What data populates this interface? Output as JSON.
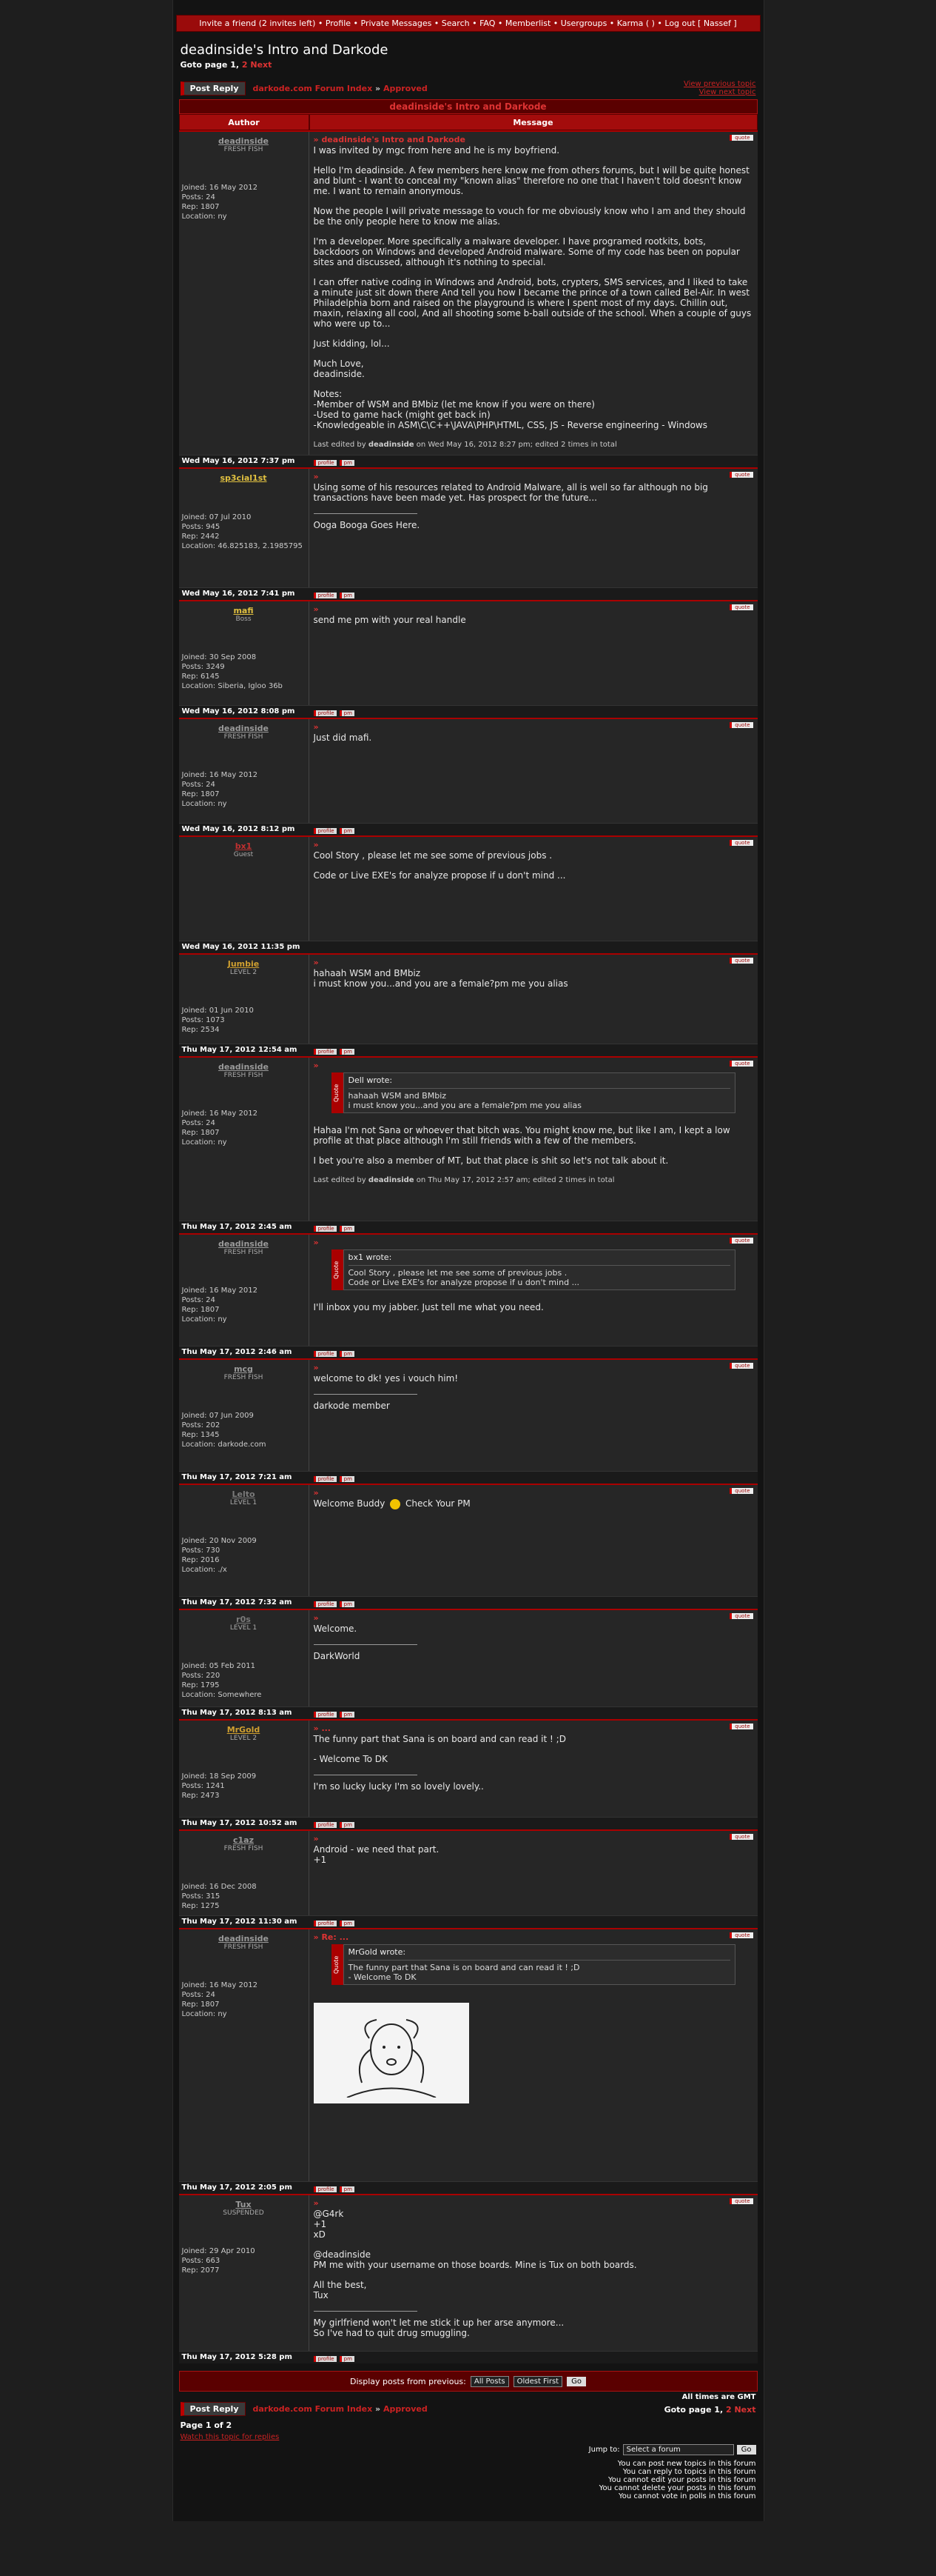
{
  "topnav": {
    "text": "Invite a friend (2 invites left) • Profile • Private Messages • Search • FAQ • Memberlist • Usergroups • Karma ( ) • Log out [ Nassef ]"
  },
  "thread": {
    "title": "deadinside's Intro and Darkode",
    "goto_prefix": "Goto page",
    "goto_current": "1, ",
    "page2": "2",
    "next": "Next"
  },
  "toolbar": {
    "post_reply": "Post Reply",
    "crumb_index": "darkode.com Forum Index",
    "crumb_sep": " » ",
    "crumb_forum": "Approved",
    "prev_topic": "View previous topic",
    "next_topic": "View next topic"
  },
  "table": {
    "thread_header": "deadinside's Intro and Darkode",
    "col_author": "Author",
    "col_message": "Message"
  },
  "labels": {
    "quote": "quote",
    "profile": "profile",
    "pm": "pm",
    "quote_side": "Quote",
    "edited_prefix": "Last edited by",
    "edited_on": "on"
  },
  "posts": [
    {
      "author": "deadinside",
      "rank": "FRESH FISH",
      "color": "#9a9a9a",
      "joined": "Joined: 16 May 2012",
      "posts": "Posts: 24",
      "rep": "Rep: 1807",
      "location": "Location: ny",
      "subject": "deadinside's Intro and Darkode",
      "date": "Wed May 16, 2012 7:37 pm",
      "paras": [
        "I was invited by mgc from here and he is my boyfriend.",
        "Hello I'm deadinside. A few members here know me from others forums, but I will be quite honest and blunt - I want to conceal my \"known alias\" therefore no one that I haven't told doesn't know me. I want to remain anonymous.",
        "Now the people I will private message to vouch for me obviously know who I am and they should be the only people here to know me alias.",
        "I'm a developer. More specifically a malware developer. I have programed rootkits, bots, backdoors on Windows and developed Android malware. Some of my code has been on popular sites and discussed, although it's nothing to special.",
        "I can offer native coding in Windows and Android, bots, crypters, SMS services, and I liked to take a minute just sit down there And tell you how I became the prince of a town called Bel-Air. In west Philadelphia born and raised on the playground is where I spent most of my days. Chillin out, maxin, relaxing all cool, And all shooting some b-ball outside of the school. When a couple of guys who were up to...",
        "Just kidding, lol...",
        "Much Love,\ndeadinside.",
        "Notes:\n-Member of WSM and BMbiz (let me know if you were on there)\n-Used to game hack (might get back in)\n-Knowledgeable in ASM\\C\\C++\\JAVA\\PHP\\HTML, CSS, JS - Reverse engineering - Windows"
      ],
      "edited": {
        "who": "deadinside",
        "when": "Wed May 16, 2012 8:27 pm; edited 2 times in total"
      }
    },
    {
      "author": "sp3cial1st",
      "rank": "",
      "color": "#e0c040",
      "joined": "Joined: 07 Jul 2010",
      "posts": "Posts: 945",
      "rep": "Rep: 2442",
      "location": "Location: 46.825183, 2.1985795",
      "subject": "",
      "date": "Wed May 16, 2012 7:41 pm",
      "paras": [
        "Using some of his resources related to Android Malware, all is well so far although no big transactions have been made yet. Has prospect for the future..."
      ],
      "sig": "Ooga Booga Goes Here."
    },
    {
      "author": "mafi",
      "rank": "Boss",
      "color": "#e0c040",
      "joined": "Joined: 30 Sep 2008",
      "posts": "Posts: 3249",
      "rep": "Rep: 6145",
      "location": "Location: Siberia, Igloo 36b",
      "subject": "",
      "date": "Wed May 16, 2012 8:08 pm",
      "paras": [
        "send me pm with your real handle"
      ]
    },
    {
      "author": "deadinside",
      "rank": "FRESH FISH",
      "color": "#9a9a9a",
      "joined": "Joined: 16 May 2012",
      "posts": "Posts: 24",
      "rep": "Rep: 1807",
      "location": "Location: ny",
      "subject": "",
      "date": "Wed May 16, 2012 8:12 pm",
      "paras": [
        "Just did mafi."
      ]
    },
    {
      "author": "bx1",
      "rank": "Guest",
      "color": "#c03030",
      "joined": "",
      "posts": "",
      "rep": "",
      "location": "",
      "subject": "",
      "date": "Wed May 16, 2012 11:35 pm",
      "paras": [
        "Cool Story , please let me see some of previous jobs .",
        "Code or Live EXE's for analyze propose if u don't mind ..."
      ]
    },
    {
      "author": "Jumbie",
      "rank": "LEVEL 2",
      "color": "#d0a030",
      "joined": "Joined: 01 Jun 2010",
      "posts": "Posts: 1073",
      "rep": "Rep: 2534",
      "location": "",
      "subject": "",
      "date": "Thu May 17, 2012 12:54 am",
      "paras": [
        "hahaah WSM and BMbiz\ni must know you...and you are a female?pm me you alias"
      ]
    },
    {
      "author": "deadinside",
      "rank": "FRESH FISH",
      "color": "#9a9a9a",
      "joined": "Joined: 16 May 2012",
      "posts": "Posts: 24",
      "rep": "Rep: 1807",
      "location": "Location: ny",
      "subject": "",
      "date": "Thu May 17, 2012 2:45 am",
      "quote": {
        "who": "Dell wrote:",
        "lines": [
          "hahaah WSM and BMbiz",
          "i must know you...and you are a female?pm me you alias"
        ]
      },
      "paras": [
        "Hahaa I'm not Sana or whoever that bitch was. You might know me, but like I am, I kept a low profile at that place although I'm still friends with a few of the members.",
        "I bet you're also a member of MT, but that place is shit so let's not talk about it."
      ],
      "edited": {
        "who": "deadinside",
        "when": "Thu May 17, 2012 2:57 am; edited 2 times in total"
      }
    },
    {
      "author": "deadinside",
      "rank": "FRESH FISH",
      "color": "#9a9a9a",
      "joined": "Joined: 16 May 2012",
      "posts": "Posts: 24",
      "rep": "Rep: 1807",
      "location": "Location: ny",
      "subject": "",
      "date": "Thu May 17, 2012 2:46 am",
      "quote": {
        "who": "bx1 wrote:",
        "lines": [
          "Cool Story , please let me see some of previous jobs .",
          "Code or Live EXE's for analyze propose if u don't mind ..."
        ]
      },
      "paras": [
        "I'll inbox you my jabber. Just tell me what you need."
      ]
    },
    {
      "author": "mcg",
      "rank": "FRESH FISH",
      "color": "#9a9a9a",
      "joined": "Joined: 07 Jun 2009",
      "posts": "Posts: 202",
      "rep": "Rep: 1345",
      "location": "Location: darkode.com",
      "subject": "",
      "date": "Thu May 17, 2012 7:21 am",
      "paras": [
        "welcome to dk! yes i vouch him!"
      ],
      "sig": "darkode member"
    },
    {
      "author": "Lelto",
      "rank": "LEVEL 1",
      "color": "#7a7a7a",
      "joined": "Joined: 20 Nov 2009",
      "posts": "Posts: 730",
      "rep": "Rep: 2016",
      "location": "Location: ./x",
      "subject": "",
      "date": "Thu May 17, 2012 7:32 am",
      "paras": [
        "Welcome Buddy [smile] Check Your PM"
      ]
    },
    {
      "author": "r0s",
      "rank": "LEVEL 1",
      "color": "#7a7a7a",
      "joined": "Joined: 05 Feb 2011",
      "posts": "Posts: 220",
      "rep": "Rep: 1795",
      "location": "Location: Somewhere",
      "subject": "",
      "date": "Thu May 17, 2012 8:13 am",
      "paras": [
        "Welcome."
      ],
      "sig": "DarkWorld"
    },
    {
      "author": "MrGold",
      "rank": "LEVEL 2",
      "color": "#d0a030",
      "joined": "Joined: 18 Sep 2009",
      "posts": "Posts: 1241",
      "rep": "Rep: 2473",
      "location": "",
      "subject": "...",
      "date": "Thu May 17, 2012 10:52 am",
      "paras": [
        "The funny part that Sana is on board and can read it ! ;D",
        "- Welcome To DK"
      ],
      "sig": "I'm so lucky lucky I'm so lovely lovely.."
    },
    {
      "author": "c1az",
      "rank": "FRESH FISH",
      "color": "#9a9a9a",
      "joined": "Joined: 16 Dec 2008",
      "posts": "Posts: 315",
      "rep": "Rep: 1275",
      "location": "",
      "subject": "",
      "date": "Thu May 17, 2012 11:30 am",
      "paras": [
        "Android - we need that part.\n+1"
      ]
    },
    {
      "author": "deadinside",
      "rank": "FRESH FISH",
      "color": "#9a9a9a",
      "joined": "Joined: 16 May 2012",
      "posts": "Posts: 24",
      "rep": "Rep: 1807",
      "location": "Location: ny",
      "subject": "Re: ...",
      "date": "Thu May 17, 2012 2:05 pm",
      "quote": {
        "who": "MrGold wrote:",
        "lines": [
          "The funny part that Sana is on board and can read it ! ;D",
          "- Welcome To DK"
        ]
      },
      "paras": [],
      "image": true
    },
    {
      "author": "Tux",
      "rank": "SUSPENDED",
      "color": "#9a9a9a",
      "joined": "Joined: 29 Apr 2010",
      "posts": "Posts: 663",
      "rep": "Rep: 2077",
      "location": "",
      "subject": "",
      "date": "Thu May 17, 2012 5:28 pm",
      "paras": [
        "@G4rk\n+1\nxD",
        "@deadinside\nPM me with your username on those boards. Mine is Tux on both boards.",
        "All the best,\nTux"
      ],
      "sig": "My girlfriend won't let me stick it up her arse anymore...\nSo I've had to quit drug smuggling."
    }
  ],
  "bottom": {
    "display_from": "Display posts from previous:",
    "all_posts": "All Posts",
    "oldest_first": "Oldest First",
    "go": "Go",
    "all_times": "All times are GMT",
    "page_of": "Page 1 of 2",
    "watch": "Watch this topic for replies",
    "jump_to": "Jump to:",
    "select_forum": "Select a forum",
    "perms": [
      "You can post new topics in this forum",
      "You can reply to topics in this forum",
      "You cannot edit your posts in this forum",
      "You cannot delete your posts in this forum",
      "You cannot vote in polls in this forum"
    ]
  }
}
